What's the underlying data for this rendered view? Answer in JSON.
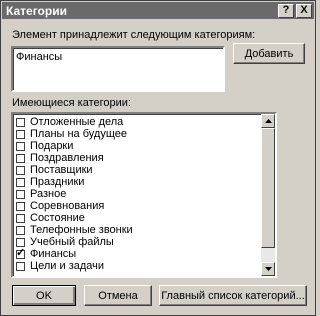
{
  "dialog": {
    "title": "Категории",
    "help_button": "?",
    "close_button": "X"
  },
  "assign": {
    "label": "Элемент принадлежит следующим категориям:",
    "value": "Финансы",
    "add_button": "Добавить"
  },
  "available": {
    "label": "Имеющиеся категории:",
    "items": [
      {
        "label": "Отложенные дела",
        "checked": false
      },
      {
        "label": "Планы на будущее",
        "checked": false
      },
      {
        "label": "Подарки",
        "checked": false
      },
      {
        "label": "Поздравления",
        "checked": false
      },
      {
        "label": "Поставщики",
        "checked": false
      },
      {
        "label": "Праздники",
        "checked": false
      },
      {
        "label": "Разное",
        "checked": false
      },
      {
        "label": "Соревнования",
        "checked": false
      },
      {
        "label": "Состояние",
        "checked": false
      },
      {
        "label": "Телефонные звонки",
        "checked": false
      },
      {
        "label": "Учебный файлы",
        "checked": false
      },
      {
        "label": "Финансы",
        "checked": true
      },
      {
        "label": "Цели и задачи",
        "checked": false
      }
    ]
  },
  "buttons": {
    "ok": "OK",
    "cancel": "Отмена",
    "master_list": "Главный список категорий..."
  }
}
